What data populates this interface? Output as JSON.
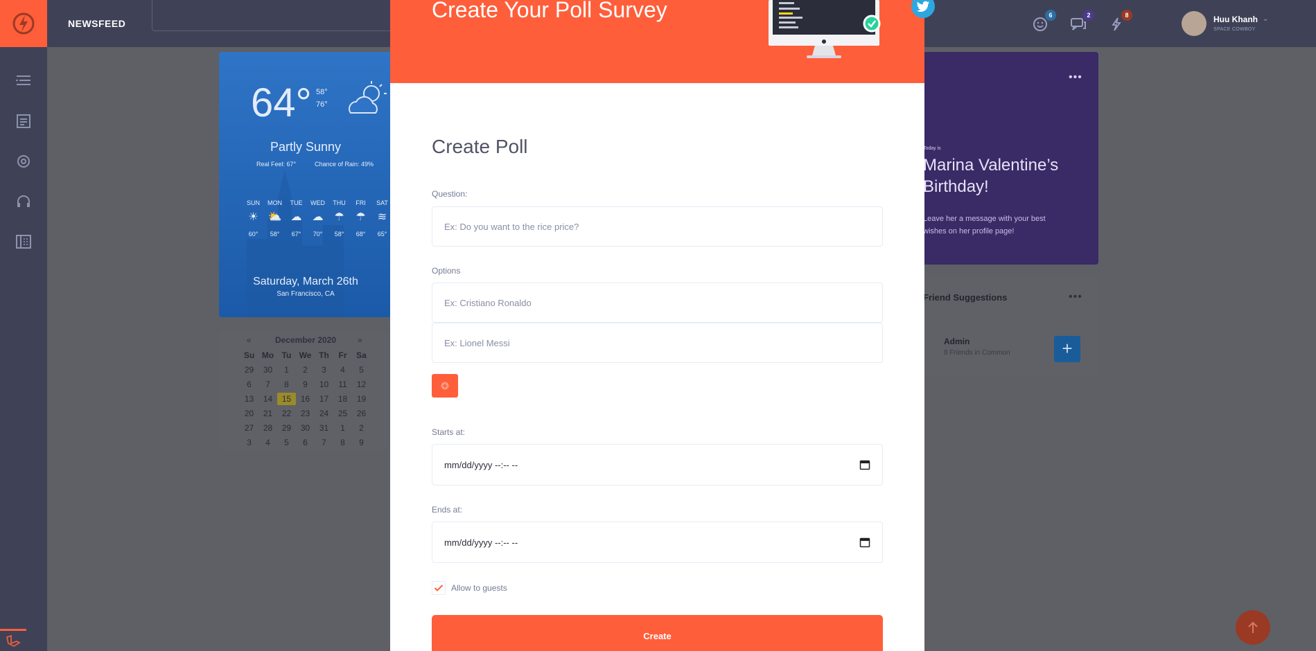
{
  "colors": {
    "accent": "#ff5e3a",
    "topbar": "#3f4257",
    "twitter": "#2ea7e0",
    "success": "#28d39c"
  },
  "header": {
    "nav_label": "NEWSFEED",
    "user_name": "Huu Khanh",
    "user_subtitle": "SPACE COWBOY",
    "badges": {
      "friends": "6",
      "messages": "2",
      "notifications": "8"
    }
  },
  "weather": {
    "temp": "64°",
    "high": "58°",
    "low": "76°",
    "condition": "Partly Sunny",
    "real_feel": "Real Feel: 67°",
    "rain": "Chance of Rain: 49%",
    "days": [
      {
        "day": "SUN",
        "temp": "60°"
      },
      {
        "day": "MON",
        "temp": "58°"
      },
      {
        "day": "TUE",
        "temp": "67°"
      },
      {
        "day": "WED",
        "temp": "70°"
      },
      {
        "day": "THU",
        "temp": "58°"
      },
      {
        "day": "FRI",
        "temp": "68°"
      },
      {
        "day": "SAT",
        "temp": "65°"
      }
    ],
    "date": "Saturday, March 26th",
    "city": "San Francisco, CA"
  },
  "calendar": {
    "prev": "«",
    "next": "»",
    "month": "December 2020",
    "day_names": [
      "Su",
      "Mo",
      "Tu",
      "We",
      "Th",
      "Fr",
      "Sa"
    ],
    "days": [
      "29",
      "30",
      "1",
      "2",
      "3",
      "4",
      "5",
      "6",
      "7",
      "8",
      "9",
      "10",
      "11",
      "12",
      "13",
      "14",
      "15",
      "16",
      "17",
      "18",
      "19",
      "20",
      "21",
      "22",
      "23",
      "24",
      "25",
      "26",
      "27",
      "28",
      "29",
      "30",
      "31",
      "1",
      "2",
      "3",
      "4",
      "5",
      "6",
      "7",
      "8",
      "9"
    ],
    "today": "15"
  },
  "birthday": {
    "today_label": "Today is",
    "name": "Marina Valentine’s Birthday!",
    "message": "Leave her a message with your best wishes on her profile page!"
  },
  "friends": {
    "title": "Friend Suggestions",
    "name": "Admin",
    "common": "8 Friends in Common"
  },
  "modal": {
    "header_title": "Create Your Poll Survey",
    "title": "Create Poll",
    "question_label": "Question:",
    "question_placeholder": "Ex: Do you want to the rice price?",
    "options_label": "Options",
    "option1_placeholder": "Ex: Cristiano Ronaldo",
    "option2_placeholder": "Ex: Lionel Messi",
    "starts_label": "Starts at:",
    "starts_value": "mm/dd/yyyy --:-- --",
    "ends_label": "Ends at:",
    "ends_value": "mm/dd/yyyy --:-- --",
    "guests_label": "Allow to guests",
    "guests_checked": true,
    "create_label": "Create"
  }
}
